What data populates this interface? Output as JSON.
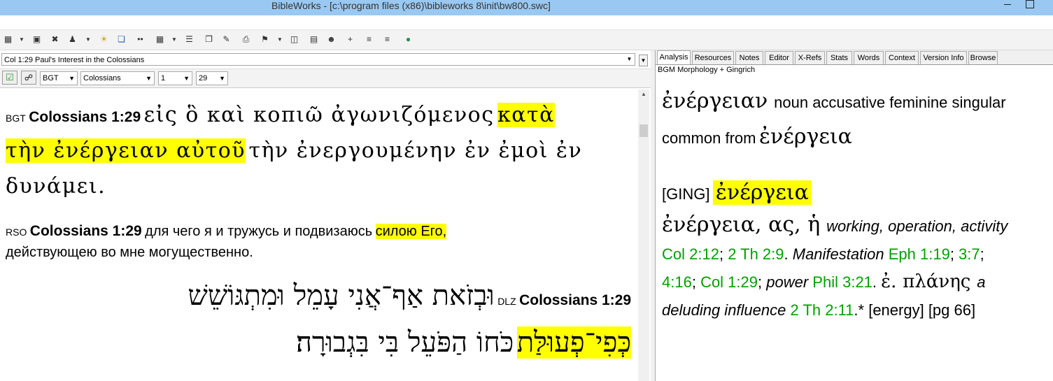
{
  "window": {
    "title": "BibleWorks - [c:\\program files (x86)\\bibleworks 8\\init\\bw800.swc]"
  },
  "toolbar": {
    "icons": [
      "search-icon",
      "toolbar-icon",
      "toolbar-icon",
      "toolbar-icon",
      "toolbar-icon",
      "toolbar-icon",
      "toolbar-icon",
      "toolbar-icon",
      "toolbar-icon",
      "toolbar-icon",
      "toolbar-icon",
      "toolbar-icon",
      "toolbar-icon",
      "toolbar-icon",
      "toolbar-icon",
      "toolbar-icon",
      "toolbar-icon",
      "toolbar-icon",
      "globe-icon"
    ]
  },
  "left": {
    "reference": "Col 1:29 Paul's Interest in the Colossians",
    "version": "BGT",
    "book": "Colossians",
    "chapter": "1",
    "verse": "29",
    "bgt": {
      "version": "BGT",
      "ref": "Colossians 1:29",
      "l1a": "εἰς ὃ καὶ κοπιῶ ἀγωνιζόμενος",
      "l1b": "κατὰ",
      "l2a": "τὴν ἐνέργειαν αὐτοῦ",
      "l2b": "τὴν ἐνεργουμένην ἐν ἐμοὶ ἐν",
      "l3": "δυνάμει."
    },
    "rso": {
      "version": "RSO",
      "ref": "Colossians 1:29",
      "l1a": "для чего я и тружусь и подвизаюсь",
      "l1b": "силою Его,",
      "l2": "действующею во мне могущественно."
    },
    "dlz": {
      "version": "DLZ",
      "ref": "Colossians 1:29",
      "l1": "וּבְזֹאת אַף־אֲנִי עָמֵל וּמִתְגּוֹשֵׁשׁ",
      "l2a": "כְּפִי־פְעוּלַּת",
      "l2b": "כֹּחוֹ הַפֹּעֵל בִּי בִּגְבוּרָה׃"
    }
  },
  "right": {
    "tabs": [
      "Analysis",
      "Resources",
      "Notes",
      "Editor",
      "X-Refs",
      "Stats",
      "Words",
      "Context",
      "Version Info",
      "Browse"
    ],
    "active_tab": "Analysis",
    "lexicon": "BGM Morphology + Gingrich",
    "parse": {
      "word": "ἐνέργειαν",
      "desc1": "noun accusative feminine singular",
      "desc2": "common from",
      "lemma": "ἐνέργεια"
    },
    "ging": {
      "label": "[GING]",
      "headword": "ἐνέργεια",
      "entry_word": "ἐνέργεια",
      "entry_forms": ", ας, ἡ",
      "gloss1": "working, operation, activity",
      "ref1": "Col 2:12",
      "ref2": "2 Th 2:9",
      "gloss2": "Manifestation",
      "ref3": "Eph 1:19",
      "ref4": "3:7",
      "ref5": "4:16",
      "ref6": "Col 1:29",
      "gloss3": "power",
      "ref7": "Phil 3:21",
      "abbr": "ἐ.",
      "planes": "πλάνης",
      "gloss4a": "a",
      "gloss4b": "deluding influence",
      "ref8": "2 Th 2:11",
      "tail": ".* [energy] [pg 66]"
    }
  }
}
